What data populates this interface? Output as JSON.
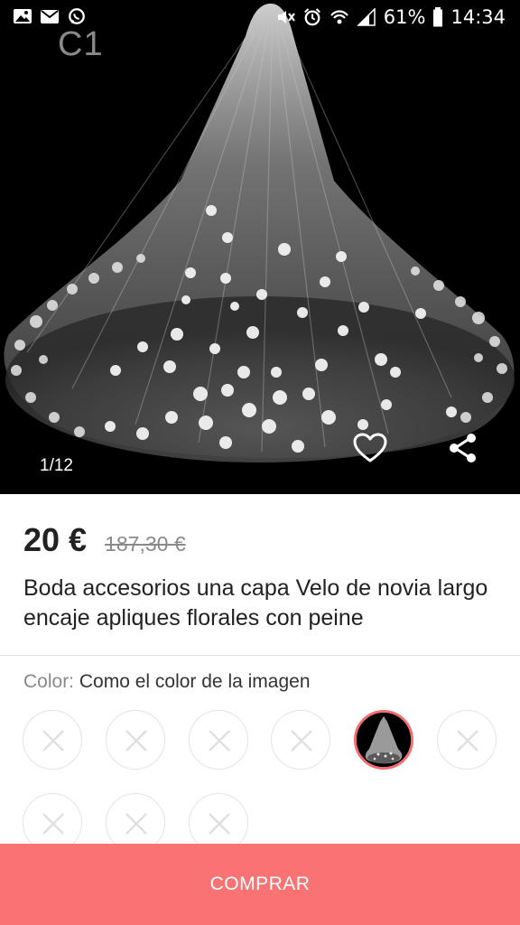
{
  "status_bar": {
    "left_icons": [
      "gallery-icon",
      "email-icon",
      "whatsapp-icon"
    ],
    "right_icons": [
      "mute-icon",
      "alarm-icon",
      "wifi-icon",
      "signal-icon"
    ],
    "battery": "61%",
    "time": "14:34"
  },
  "gallery": {
    "watermark": "C1",
    "counter": "1/12",
    "favorite_icon": "heart-outline-icon",
    "share_icon": "share-icon"
  },
  "product": {
    "price": "20 €",
    "original_price": "187,30 €",
    "title": "Boda accesorios una capa Velo de novia largo encaje apliques florales con peine"
  },
  "color_selector": {
    "label": "Color:",
    "value": "Como el color de la imagen",
    "swatches": [
      {
        "state": "unavailable"
      },
      {
        "state": "unavailable"
      },
      {
        "state": "unavailable"
      },
      {
        "state": "unavailable"
      },
      {
        "state": "selected"
      },
      {
        "state": "unavailable"
      },
      {
        "state": "unavailable"
      },
      {
        "state": "unavailable"
      },
      {
        "state": "unavailable"
      }
    ]
  },
  "actions": {
    "buy_label": "COMPRAR"
  },
  "colors": {
    "accent": "#f97373",
    "selected_ring": "#f26d6d",
    "text_primary": "#222222",
    "text_secondary": "#8a8a8a"
  }
}
